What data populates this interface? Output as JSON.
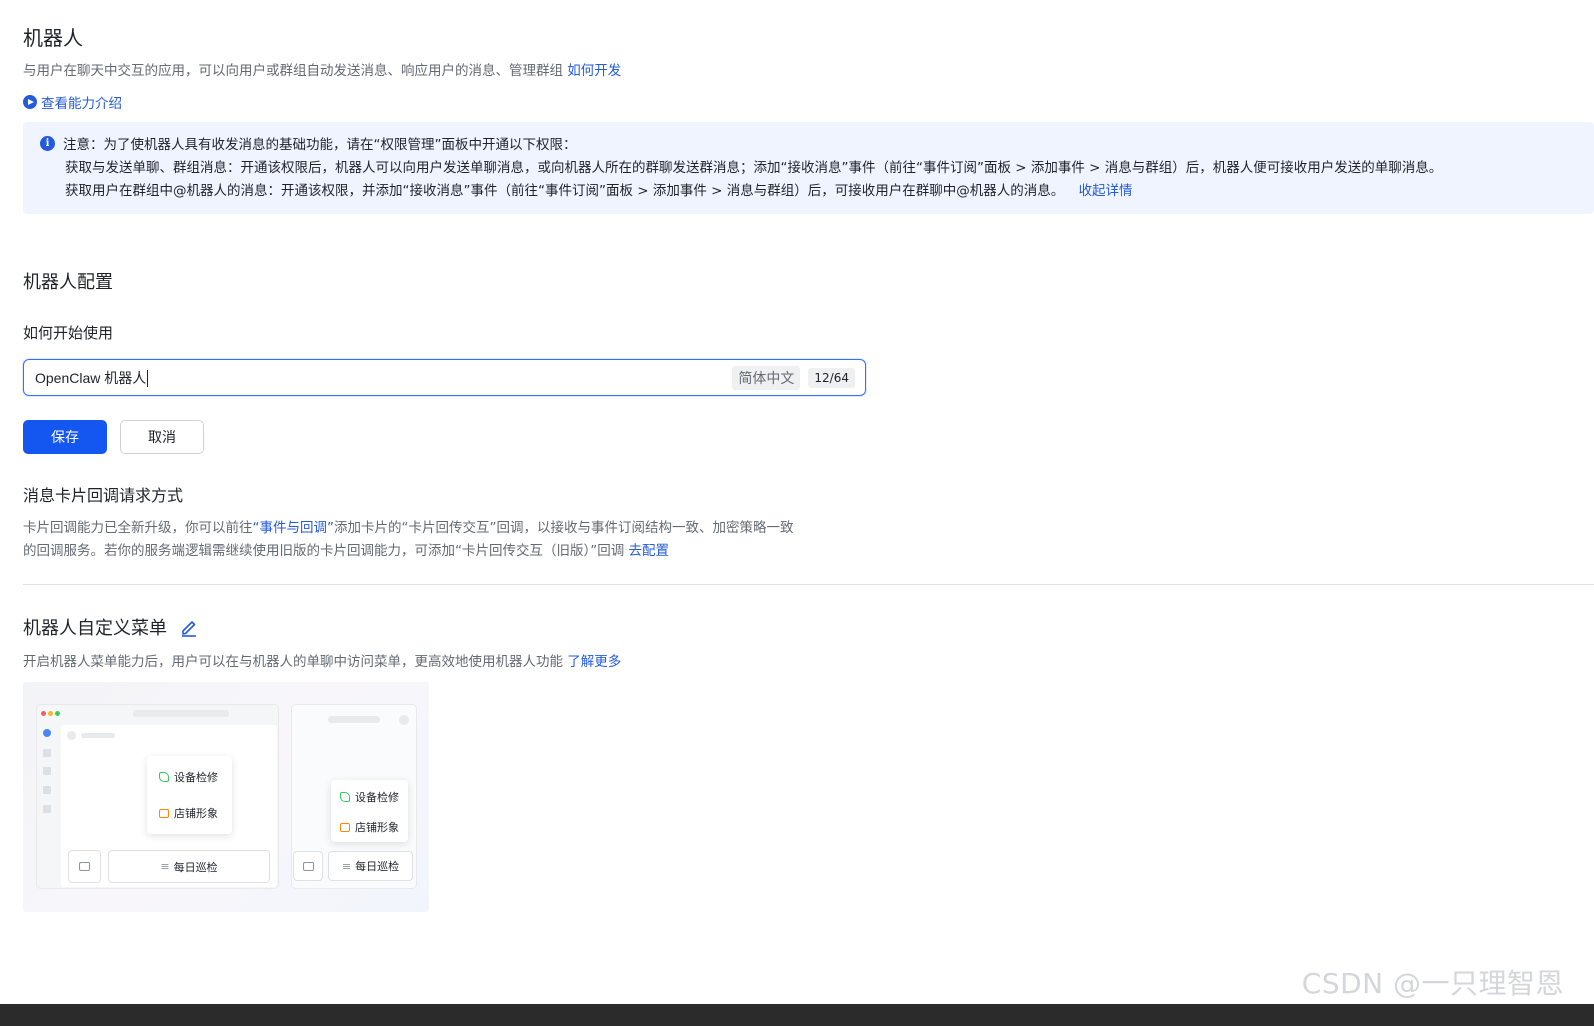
{
  "header": {
    "title": "机器人",
    "subtitle": "与用户在聊天中交互的应用，可以向用户或群组自动发送消息、响应用户的消息、管理群组",
    "how_to_link": "如何开发",
    "intro_link": "查看能力介绍"
  },
  "notice": {
    "line1": "注意：为了使机器人具有收发消息的基础功能，请在“权限管理”面板中开通以下权限：",
    "p1": "获取与发送单聊、群组消息：开通该权限后，机器人可以向用户发送单聊消息，或向机器人所在的群聊发送群消息；添加“接收消息”事件（前往“事件订阅”面板 > 添加事件 > 消息与群组）后，机器人便可接收用户发送的单聊消息。",
    "p2": "获取用户在群组中@机器人的消息：开通该权限，并添加“接收消息”事件（前往“事件订阅”面板 > 添加事件 > 消息与群组）后，可接收用户在群聊中@机器人的消息。",
    "collapse_link": "收起详情"
  },
  "config": {
    "section_title": "机器人配置",
    "field_label": "如何开始使用",
    "input_value": "OpenClaw 机器人",
    "lang_tag": "简体中文",
    "char_count": "12/64",
    "save_label": "保存",
    "cancel_label": "取消"
  },
  "callback": {
    "title": "消息卡片回调请求方式",
    "line1_a": "卡片回调能力已全新升级，你可以前往",
    "line1_link": "“事件与回调”",
    "line1_b": "添加卡片的“卡片回传交互”回调，以接收与事件订阅结构一致、加密策略一致",
    "line2": "的回调服务。若你的服务端逻辑需继续使用旧版的卡片回调能力，可添加“卡片回传交互（旧版）”回调",
    "config_link": "去配置"
  },
  "menu": {
    "title": "机器人自定义菜单",
    "desc": "开启机器人菜单能力后，用户可以在与机器人的单聊中访问菜单，更高效地使用机器人功能",
    "learn_more": "了解更多",
    "preview": {
      "item1": "设备检修",
      "item2": "店铺形象",
      "bar_item": "每日巡检"
    }
  },
  "watermark": "CSDN @一只理智恩",
  "colors": {
    "accent": "#245bdb",
    "primary_button": "#1456f0",
    "notice_bg": "#f0f4ff"
  }
}
